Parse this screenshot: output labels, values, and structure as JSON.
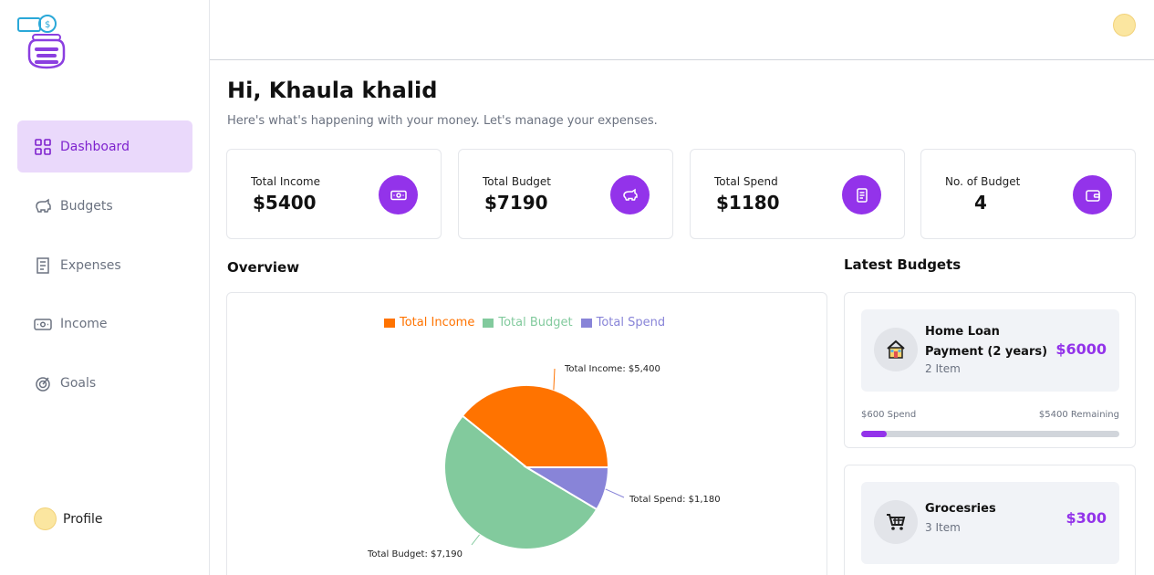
{
  "sidebar": {
    "items": [
      {
        "label": "Dashboard",
        "icon": "dashboard-icon",
        "active": true
      },
      {
        "label": "Budgets",
        "icon": "piggy-bank-icon",
        "active": false
      },
      {
        "label": "Expenses",
        "icon": "receipt-icon",
        "active": false
      },
      {
        "label": "Income",
        "icon": "money-icon",
        "active": false
      },
      {
        "label": "Goals",
        "icon": "goal-icon",
        "active": false
      }
    ],
    "profile_label": "Profile"
  },
  "header": {
    "greeting": "Hi, Khaula khalid",
    "subtitle": "Here's what's happening with your money. Let's manage your expenses."
  },
  "stats": [
    {
      "label": "Total Income",
      "value": "$5400",
      "icon": "money-icon"
    },
    {
      "label": "Total Budget",
      "value": "$7190",
      "icon": "piggy-bank-icon"
    },
    {
      "label": "Total Spend",
      "value": "$1180",
      "icon": "receipt-icon"
    },
    {
      "label": "No. of Budget",
      "value": "4",
      "icon": "wallet-icon"
    }
  ],
  "overview": {
    "title": "Overview"
  },
  "chart_data": {
    "type": "pie",
    "title": "",
    "series": [
      {
        "name": "Total Income",
        "value": 5400,
        "color": "#ff7300",
        "data_label": "Total Income: $5,400"
      },
      {
        "name": "Total Budget",
        "value": 7190,
        "color": "#82ca9d",
        "data_label": "Total Budget: $7,190"
      },
      {
        "name": "Total Spend",
        "value": 1180,
        "color": "#8884d8",
        "data_label": "Total Spend: $1,180"
      }
    ],
    "legend": "top-center"
  },
  "latest_budgets": {
    "title": "Latest Budgets",
    "items": [
      {
        "name": "Home Loan Payment (2 years)",
        "items_text": "2 Item",
        "amount": "$6000",
        "icon": "house-icon",
        "spend_text": "$600 Spend",
        "remaining_text": "$5400 Remaining",
        "progress": 0.1
      },
      {
        "name": "Grocesries",
        "items_text": "3 Item",
        "amount": "$300",
        "icon": "cart-icon"
      }
    ]
  },
  "colors": {
    "accent": "#9333ea",
    "active_nav_bg": "#ead9fb"
  }
}
